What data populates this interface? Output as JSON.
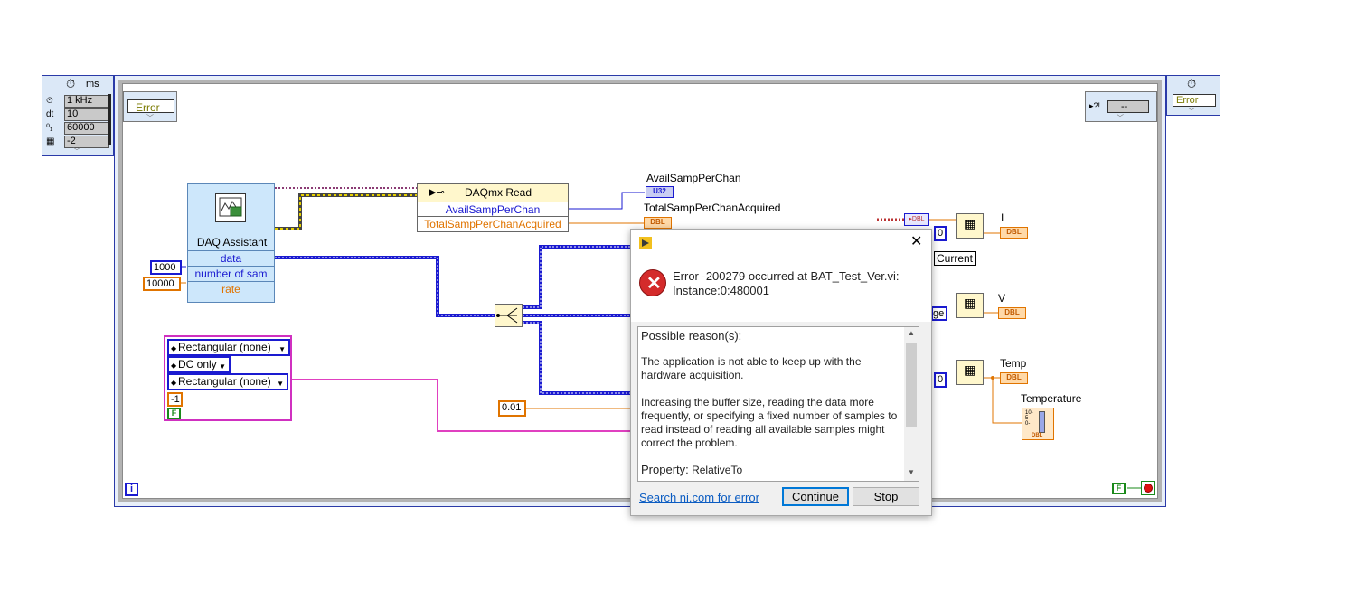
{
  "timing_left": {
    "unit": "ms",
    "rows": [
      {
        "label": "1 kHz",
        "icon": "clock-source-icon"
      },
      {
        "label": "dt",
        "value": "10"
      },
      {
        "label": "60000",
        "icon": "offset-icon"
      },
      {
        "label": "-2",
        "icon": "processor-icon"
      }
    ]
  },
  "error_cluster_left": "Error",
  "error_cluster_right_in": "--",
  "error_cluster_right_out": "Error",
  "daq_assistant": {
    "title": "DAQ Assistant",
    "data": "data",
    "number_of_samples": "number of sam",
    "rate": "rate"
  },
  "constants": {
    "samples": "1000",
    "rate": "10000",
    "tolerance": "0.01",
    "window_neg": "-1",
    "false_const": "F"
  },
  "daqmx_read": {
    "title": "DAQmx Read",
    "prop1": "AvailSampPerChan",
    "prop2": "TotalSampPerChanAcquired"
  },
  "indicators": {
    "avail_label": "AvailSampPerChan",
    "avail_type": "U32",
    "total_label": "TotalSampPerChanAcquired",
    "total_type": "DBL",
    "i_label": "I",
    "v_label": "V",
    "temp_label": "Temp",
    "temperature_label": "Temperature",
    "dbl": "DBL",
    "current_label": "Current",
    "voltage_partial": "ge",
    "index_zero": "0"
  },
  "filter_options": {
    "window1": "Rectangular (none)",
    "dc": "DC only",
    "window2": "Rectangular (none)"
  },
  "loop_info": "i",
  "stop_false": "F",
  "dialog": {
    "error_title_line1": "Error -200279 occurred at BAT_Test_Ver.vi:",
    "error_title_line2": "Instance:0:480001",
    "reason_header": "Possible reason(s):",
    "reason_p1": "The application is not able to keep up with the hardware acquisition.",
    "reason_p2": "Increasing the buffer size, reading the data more frequently, or specifying a fixed number of samples to read instead of reading all available samples might correct the problem.",
    "property_label": "Property:",
    "property_value": "RelativeTo",
    "search_link": "Search ni.com for error",
    "continue_label": "Continue",
    "stop_label": "Stop"
  }
}
